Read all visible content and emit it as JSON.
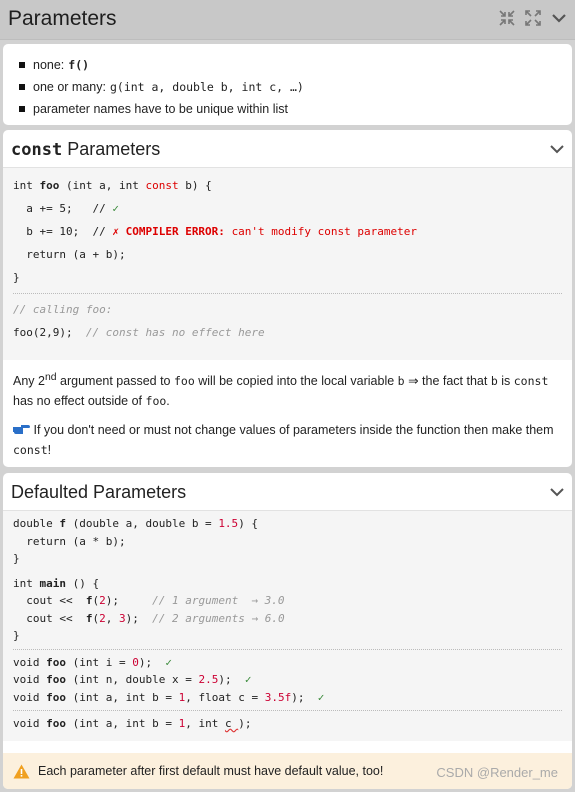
{
  "header": {
    "title": "Parameters",
    "icons": [
      "collapse-icon",
      "expand-icon",
      "chevron-down-icon"
    ]
  },
  "summary": {
    "items": [
      {
        "text": "none:",
        "code": "f()"
      },
      {
        "text": "one or many:",
        "code": "g(int a, double b, int c, …)"
      },
      {
        "text": "parameter names have to be unique within list",
        "code": ""
      }
    ]
  },
  "const_section": {
    "title_kw": "const",
    "title_rest": " Parameters",
    "code": {
      "l1": "int foo (int a, int const b) {",
      "l2": "  a += 5;   // ",
      "l3a": "  b += 10;  // ",
      "l3b": "✗ COMPILER ERROR: ",
      "l3c": "can't modify const parameter",
      "l4": "  return (a + b);",
      "l5": "}",
      "l6": "// calling foo:",
      "l7a": "foo(2,9);  ",
      "l7b": "// const has no effect here"
    },
    "prose1_a": "Any 2",
    "prose1_sup": "nd",
    "prose1_b": " argument passed to ",
    "prose1_code1": "foo",
    "prose1_c": " will be copied into the local variable ",
    "prose1_code2": "b",
    "prose1_d": " ⇒ the fact that ",
    "prose1_code3": "b",
    "prose1_e": " is ",
    "prose1_code4": "const",
    "prose1_f": " has no effect outside of ",
    "prose1_code5": "foo",
    "prose1_g": ".",
    "prose2_a": " If you don't need or must not change values of parameters inside the function then make them ",
    "prose2_code": "const",
    "prose2_b": "!"
  },
  "default_section": {
    "title": "Defaulted Parameters",
    "warning": "Each parameter after first default must have default value, too!",
    "watermark": "CSDN @Render_me"
  }
}
